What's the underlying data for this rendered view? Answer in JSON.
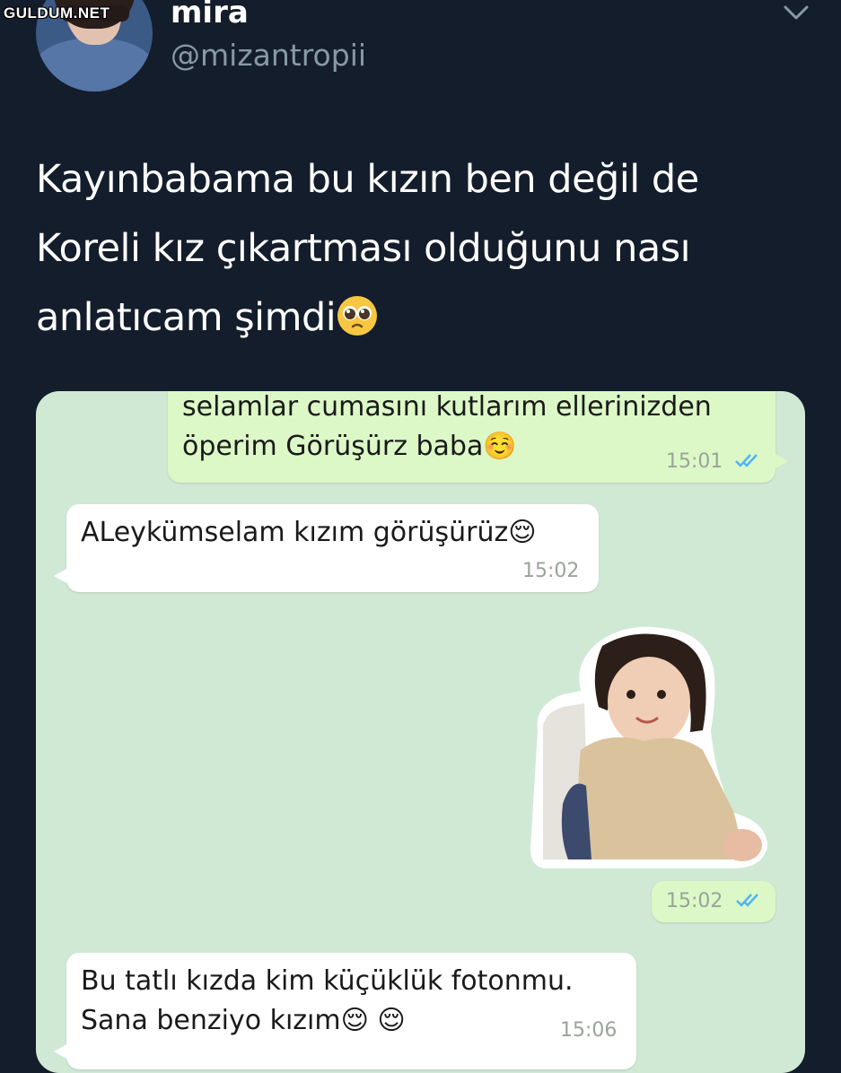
{
  "watermark": "GULDUM.NET",
  "tweet": {
    "display_name": "mira",
    "handle": "@mizantropii",
    "text_line1": "Kayınbabama bu kızın ben değil de",
    "text_line2": "Koreli kız çıkartması olduğunu nası",
    "text_line3": "anlatıcam şimdi",
    "text_emoji": "🥺",
    "menu_icon": "chevron-down-icon",
    "avatar_icon": "avatar"
  },
  "chat": {
    "background_color": "#cfe9d5",
    "messages": [
      {
        "direction": "outgoing",
        "line1": "selamlar cumasını kutlarım ellerinizden",
        "line2": "öperim Görüşürz baba☺️",
        "time": "15:01",
        "status": "read"
      },
      {
        "direction": "incoming",
        "line1": "ALeykümselam kızım görüşürüz😌",
        "time": "15:02"
      },
      {
        "direction": "outgoing",
        "type": "sticker",
        "sticker_desc": "sticker-child-photo",
        "time": "15:02",
        "status": "read"
      },
      {
        "direction": "incoming",
        "line1": "Bu tatlı kızda kim küçüklük fotonmu.",
        "line2": "Sana benziyo kızım😌 😌",
        "time": "15:06"
      }
    ]
  },
  "colors": {
    "background": "#141d2b",
    "outgoing_bubble": "#dcf8c6",
    "incoming_bubble": "#ffffff",
    "read_tick": "#4fb3f6"
  }
}
